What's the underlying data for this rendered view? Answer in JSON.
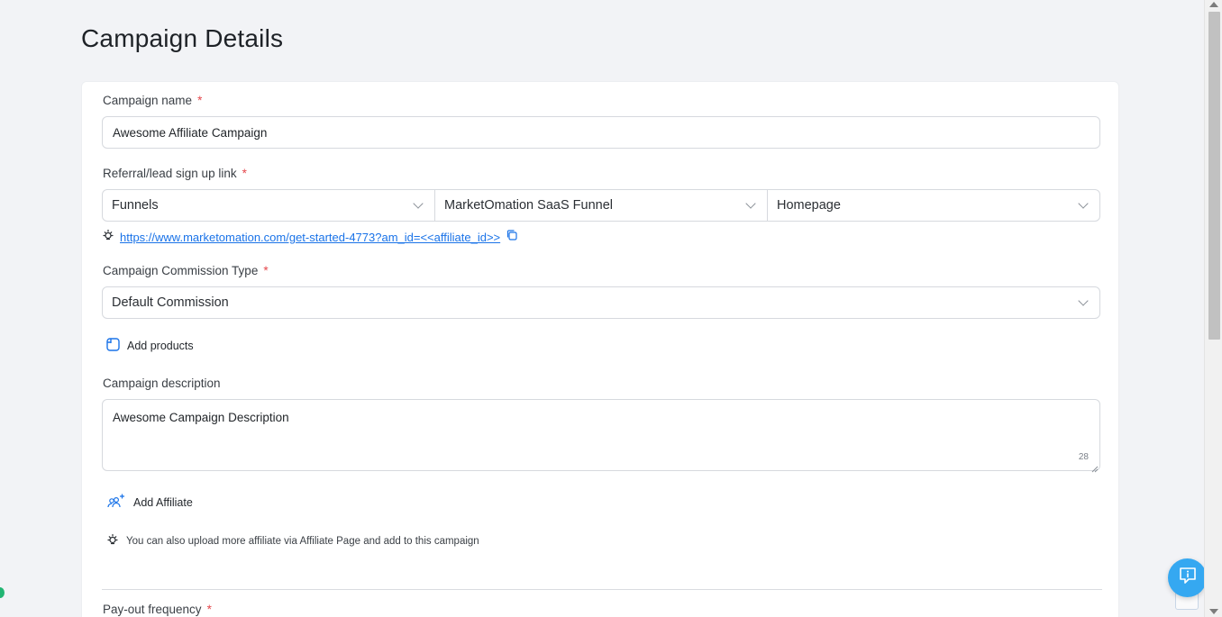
{
  "page": {
    "title": "Campaign Details"
  },
  "form": {
    "campaign_name": {
      "label": "Campaign name",
      "required_mark": "*",
      "value": "Awesome Affiliate Campaign"
    },
    "signup_link": {
      "label": "Referral/lead sign up link",
      "required_mark": "*",
      "selects": [
        "Funnels",
        "MarketOmation SaaS Funnel",
        "Homepage"
      ],
      "url": "https://www.marketomation.com/get-started-4773?am_id=<<affiliate_id>>"
    },
    "commission_type": {
      "label": "Campaign Commission Type",
      "required_mark": "*",
      "value": "Default Commission"
    },
    "add_products_label": "Add products",
    "description": {
      "label": "Campaign description",
      "value": "Awesome Campaign Description",
      "char_count": "28"
    },
    "add_affiliate_label": "Add Affiliate",
    "affiliate_hint": "You can also upload more affiliate via Affiliate Page and add to this campaign",
    "payout_frequency": {
      "label": "Pay-out frequency",
      "required_mark": "*"
    }
  },
  "colors": {
    "accent": "#1a73e8",
    "required": "#e5484d",
    "help_button": "#35a8f1"
  },
  "icons": [
    "lightbulb-icon",
    "copy-icon",
    "add-products-icon",
    "add-affiliate-icon",
    "help-chat-icon",
    "chevron-down-icon"
  ]
}
